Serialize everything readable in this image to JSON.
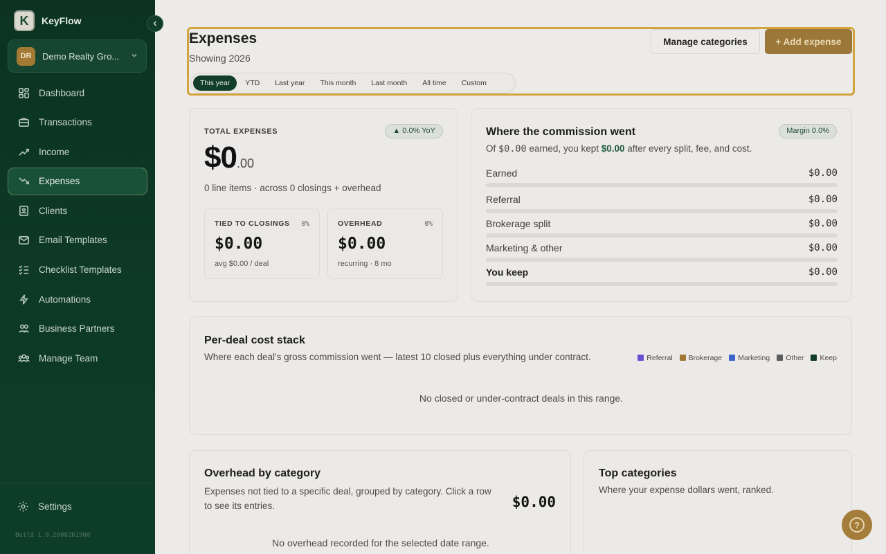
{
  "app": {
    "name": "KeyFlow",
    "logo_letter": "K"
  },
  "org": {
    "initials": "DR",
    "name": "Demo Realty Gro..."
  },
  "sidebar": {
    "items": [
      {
        "label": "Dashboard",
        "icon": "grid-icon"
      },
      {
        "label": "Transactions",
        "icon": "briefcase-icon"
      },
      {
        "label": "Income",
        "icon": "trend-up-icon"
      },
      {
        "label": "Expenses",
        "icon": "trend-down-icon",
        "active": true
      },
      {
        "label": "Clients",
        "icon": "contacts-icon"
      },
      {
        "label": "Email Templates",
        "icon": "mail-icon"
      },
      {
        "label": "Checklist Templates",
        "icon": "checklist-icon"
      },
      {
        "label": "Automations",
        "icon": "lightning-icon"
      },
      {
        "label": "Business Partners",
        "icon": "partners-icon"
      },
      {
        "label": "Manage Team",
        "icon": "team-icon"
      }
    ],
    "settings_label": "Settings",
    "build": "Build 1.0.2608261900"
  },
  "header": {
    "title": "Expenses",
    "subtitle": "Showing 2026",
    "manage_label": "Manage categories",
    "add_label": "+ Add expense",
    "filters": [
      "This year",
      "YTD",
      "Last year",
      "This month",
      "Last month",
      "All time",
      "Custom"
    ],
    "active_filter": "This year"
  },
  "total": {
    "label": "TOTAL EXPENSES",
    "badge": "▲ 0.0% YoY",
    "amount_main": "$0",
    "amount_cents": ".00",
    "summary": "0 line items · across 0 closings + overhead",
    "tied": {
      "label": "TIED TO CLOSINGS",
      "pct": "0%",
      "amount": "$0.00",
      "note": "avg $0.00 / deal"
    },
    "overhead": {
      "label": "OVERHEAD",
      "pct": "0%",
      "amount": "$0.00",
      "note": "recurring · 8 mo"
    }
  },
  "commission": {
    "title": "Where the commission went",
    "badge": "Margin 0.0%",
    "desc_prefix": "Of ",
    "desc_earned": "$0.00",
    "desc_mid": " earned, you kept ",
    "desc_kept": "$0.00",
    "desc_suffix": " after every split, fee, and cost.",
    "rows": [
      {
        "label": "Earned",
        "value": "$0.00"
      },
      {
        "label": "Referral",
        "value": "$0.00"
      },
      {
        "label": "Brokerage split",
        "value": "$0.00"
      },
      {
        "label": "Marketing & other",
        "value": "$0.00"
      },
      {
        "label": "You keep",
        "value": "$0.00"
      }
    ]
  },
  "cost_stack": {
    "title": "Per-deal cost stack",
    "desc": "Where each deal's gross commission went — latest 10 closed plus everything under contract.",
    "legend": [
      {
        "label": "Referral",
        "color": "#6a4fd1"
      },
      {
        "label": "Brokerage",
        "color": "#a07a35"
      },
      {
        "label": "Marketing",
        "color": "#3f64c9"
      },
      {
        "label": "Other",
        "color": "#5c5c5c"
      },
      {
        "label": "Keep",
        "color": "#123d2a"
      }
    ],
    "empty": "No closed or under-contract deals in this range."
  },
  "overhead_card": {
    "title": "Overhead by category",
    "desc": "Expenses not tied to a specific deal, grouped by category. Click a row to see its entries.",
    "amount": "$0.00",
    "empty": "No overhead recorded for the selected date range."
  },
  "top_categories": {
    "title": "Top categories",
    "desc": "Where your expense dollars went, ranked."
  },
  "help_label": "?"
}
